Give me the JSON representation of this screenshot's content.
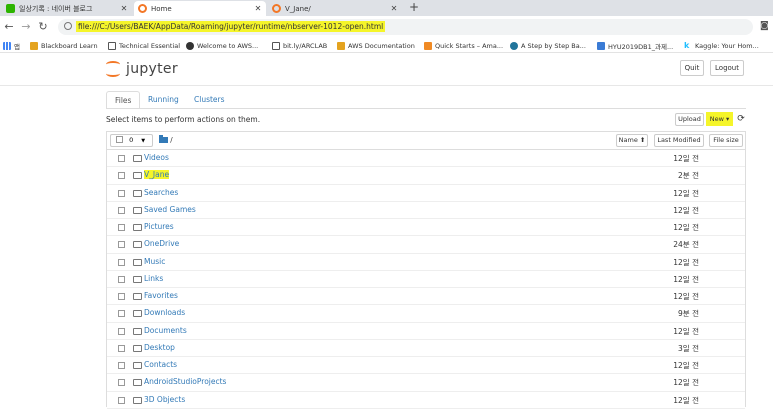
{
  "browser": {
    "tabs": [
      {
        "title": "일상기록 : 네이버 블로그",
        "active": false,
        "favicon_color": "#2db400"
      },
      {
        "title": "Home",
        "active": true,
        "favicon_color": "#f37726"
      },
      {
        "title": "V_Jane/",
        "active": false,
        "favicon_color": "#f37726"
      }
    ],
    "new_tab": "+",
    "close_glyph": "✕",
    "url": "file:///C:/Users/BAEK/AppData/Roaming/jupyter/runtime/nbserver-1012-open.html",
    "bookmarks": [
      {
        "label": "앱",
        "color": "#4285f4"
      },
      {
        "label": "Blackboard Learn",
        "color": "#e4a31f"
      },
      {
        "label": "Technical Essential",
        "color": "#555555"
      },
      {
        "label": "Welcome to AWS...",
        "color": "#333333"
      },
      {
        "label": "bit.ly/ARCLAB",
        "color": "#555555"
      },
      {
        "label": "AWS Documentation",
        "color": "#e4a31f"
      },
      {
        "label": "Quick Starts – Ama...",
        "color": "#f08a24"
      },
      {
        "label": "A Step by Step Ba...",
        "color": "#21759b"
      },
      {
        "label": "HYU2019DB1_과제...",
        "color": "#3a7bd5"
      },
      {
        "label": "Kaggle: Your Hom...",
        "color": "#20beff"
      }
    ]
  },
  "jupyter": {
    "logo_text": "jupyter",
    "quit_label": "Quit",
    "logout_label": "Logout",
    "tabs": [
      "Files",
      "Running",
      "Clusters"
    ],
    "select_text": "Select items to perform actions on them.",
    "upload_label": "Upload",
    "new_label": "New ▾",
    "refresh_glyph": "⟳",
    "selected_count": "0",
    "breadcrumb": "/",
    "sort_name_label": "Name ⬆",
    "last_modified_label": "Last Modified",
    "file_size_label": "File size",
    "files": [
      {
        "name": "Videos",
        "modified": "12일 전",
        "highlighted": false
      },
      {
        "name": "V_Jane",
        "modified": "2분 전",
        "highlighted": true
      },
      {
        "name": "Searches",
        "modified": "12일 전",
        "highlighted": false
      },
      {
        "name": "Saved Games",
        "modified": "12일 전",
        "highlighted": false
      },
      {
        "name": "Pictures",
        "modified": "12일 전",
        "highlighted": false
      },
      {
        "name": "OneDrive",
        "modified": "24분 전",
        "highlighted": false
      },
      {
        "name": "Music",
        "modified": "12일 전",
        "highlighted": false
      },
      {
        "name": "Links",
        "modified": "12일 전",
        "highlighted": false
      },
      {
        "name": "Favorites",
        "modified": "12일 전",
        "highlighted": false
      },
      {
        "name": "Downloads",
        "modified": "9분 전",
        "highlighted": false
      },
      {
        "name": "Documents",
        "modified": "12일 전",
        "highlighted": false
      },
      {
        "name": "Desktop",
        "modified": "3일 전",
        "highlighted": false
      },
      {
        "name": "Contacts",
        "modified": "12일 전",
        "highlighted": false
      },
      {
        "name": "AndroidStudioProjects",
        "modified": "12일 전",
        "highlighted": false
      },
      {
        "name": "3D Objects",
        "modified": "12일 전",
        "highlighted": false
      }
    ]
  }
}
